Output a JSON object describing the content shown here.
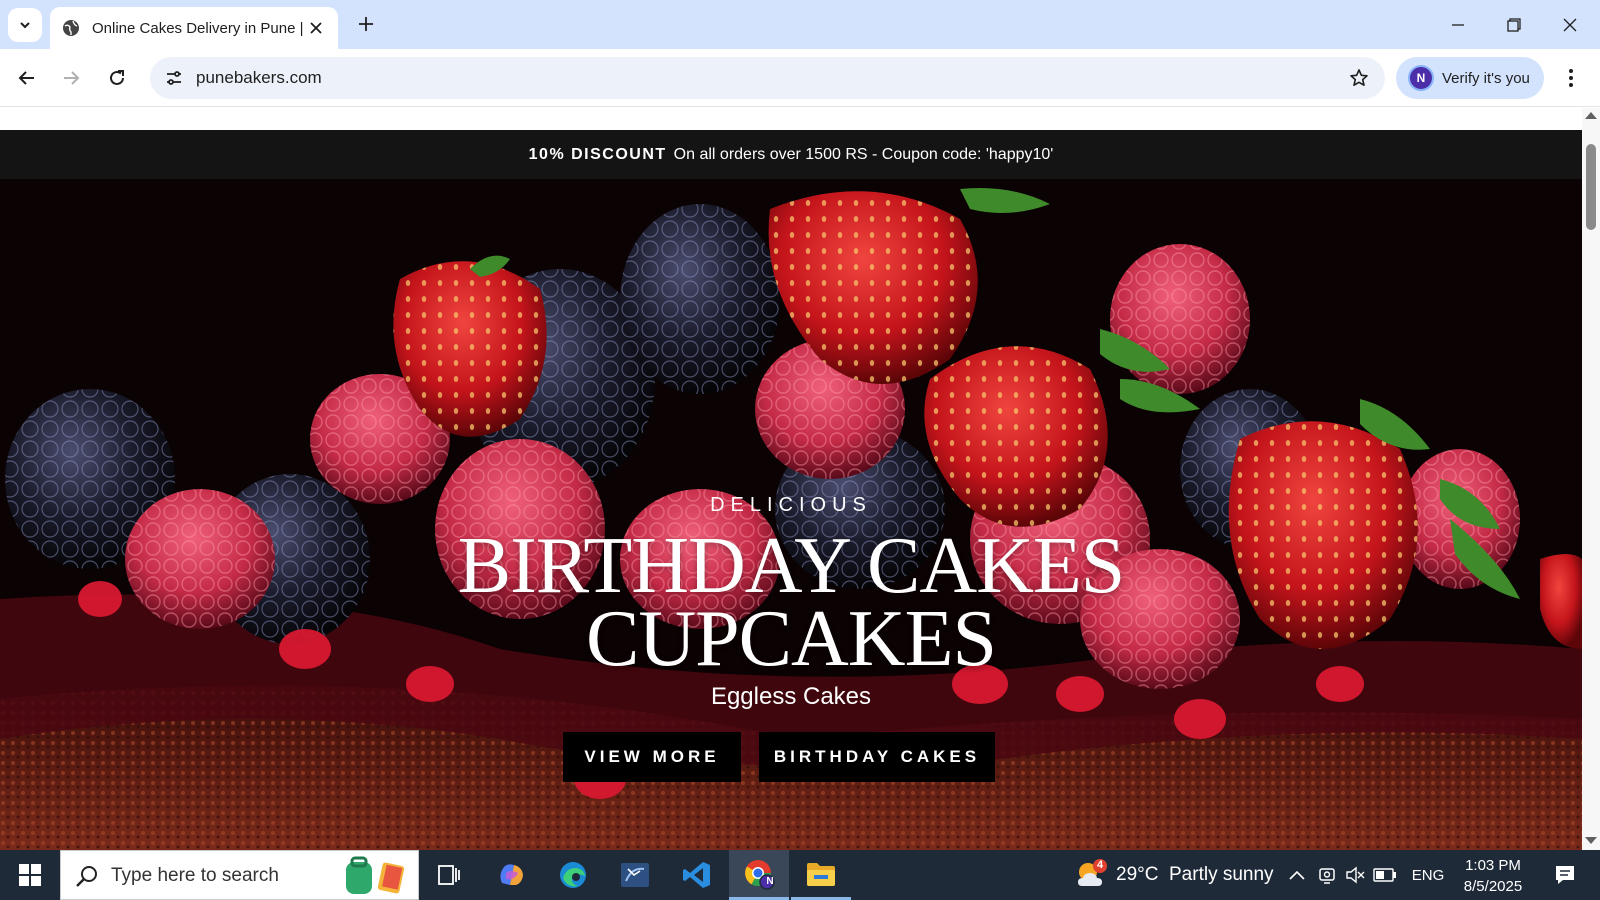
{
  "browser": {
    "tab_title": "Online Cakes Delivery in Pune |",
    "url": "punebakers.com",
    "profile_initial": "N",
    "profile_chip_label": "Verify it's you"
  },
  "page": {
    "announcement": {
      "highlight": "10% DISCOUNT",
      "text": "On all orders over 1500 RS - Coupon code: 'happy10'"
    },
    "hero": {
      "eyebrow": "DELICIOUS",
      "title_line1": "BIRTHDAY CAKES",
      "title_line2": "CUPCAKES",
      "subtitle": "Eggless Cakes",
      "buttons": [
        "VIEW MORE",
        "BIRTHDAY CAKES"
      ]
    }
  },
  "taskbar": {
    "search_placeholder": "Type here to search",
    "weather_badge": "4",
    "weather": "29°C  Partly sunny",
    "language": "ENG",
    "time": "1:03 PM",
    "date": "8/5/2025",
    "chrome_badge_initial": "N",
    "apps": [
      "task-view",
      "copilot",
      "edge",
      "app-blue",
      "vscode",
      "chrome",
      "file-explorer"
    ]
  },
  "colors": {
    "tabstrip": "#d3e3fd",
    "announcement_bar": "#141414",
    "hero_button": "#000000",
    "taskbar": "#1f2a38"
  }
}
